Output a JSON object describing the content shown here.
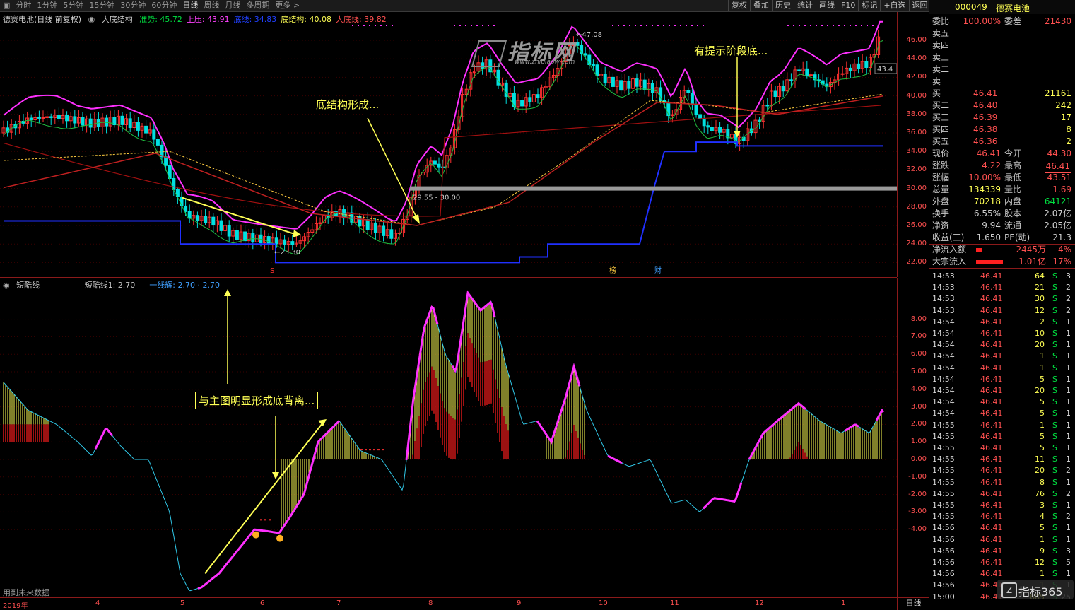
{
  "menu": {
    "tabs": [
      "分时",
      "1分钟",
      "5分钟",
      "15分钟",
      "30分钟",
      "60分钟",
      "日线",
      "周线",
      "月线",
      "多周期",
      "更多 >"
    ],
    "active_tab": "日线",
    "tools": [
      "复权",
      "叠加",
      "历史",
      "统计",
      "画线",
      "F10",
      "标记",
      "+自选",
      "返回"
    ]
  },
  "stock": {
    "code": "000049",
    "name": "德赛电池"
  },
  "main_header": {
    "title": "德赛电池(日线 前复权)",
    "indicator": "大底结构",
    "items": [
      {
        "label": "准势: 45.72",
        "color": "#00e040"
      },
      {
        "label": "上压: 43.91",
        "color": "#ff40ff"
      },
      {
        "label": "底线: 34.83",
        "color": "#2040ff"
      },
      {
        "label": "底结构: 40.08",
        "color": "#ffff55"
      },
      {
        "label": "大底线: 39.82",
        "color": "#ff5050"
      }
    ]
  },
  "indicator_header": {
    "name": "短酷线",
    "items": [
      {
        "label": "短酷线1: 2.70",
        "color": "#c8c8c8"
      },
      {
        "label": "一线辉: 2.70 · 2.70",
        "color": "#40a0ff"
      }
    ]
  },
  "annotations": {
    "bottom_formed": "底结构形成...",
    "stage_bottom": "有提示阶段底...",
    "divergence": "与主图明显形成底背离...",
    "future_data": "用到未来数据"
  },
  "chart_labels": {
    "high": "47.08",
    "low": "23.30",
    "range": "29.55 - 30.00",
    "last": "43.4",
    "marker_bang": "榜",
    "marker_cai": "财",
    "marker_s": "S"
  },
  "watermark": {
    "text": "指标网",
    "url": "www.zhibiaow.com",
    "corner": "指标365"
  },
  "price_axis": [
    "46.00",
    "44.00",
    "42.00",
    "40.00",
    "38.00",
    "36.00",
    "34.00",
    "32.00",
    "30.00",
    "28.00",
    "26.00",
    "24.00",
    "22.00"
  ],
  "indicator_axis": [
    "8.00",
    "7.00",
    "6.00",
    "5.00",
    "4.00",
    "3.00",
    "2.00",
    "1.00",
    "0.00",
    "-1.00",
    "-2.00",
    "-3.00",
    "-4.00"
  ],
  "date_axis": {
    "labels": [
      "2019年",
      "4",
      "5",
      "6",
      "7",
      "8",
      "9",
      "10",
      "11",
      "12",
      "1"
    ],
    "period": "日线"
  },
  "quote": {
    "weibi": {
      "label": "委比",
      "value": "100.00%",
      "label2": "委差",
      "value2": "21430"
    },
    "asks": [
      {
        "label": "卖五",
        "price": "",
        "vol": ""
      },
      {
        "label": "卖四",
        "price": "",
        "vol": ""
      },
      {
        "label": "卖三",
        "price": "",
        "vol": ""
      },
      {
        "label": "卖二",
        "price": "",
        "vol": ""
      },
      {
        "label": "卖一",
        "price": "",
        "vol": ""
      }
    ],
    "bids": [
      {
        "label": "买一",
        "price": "46.41",
        "vol": "21161"
      },
      {
        "label": "买二",
        "price": "46.40",
        "vol": "242"
      },
      {
        "label": "买三",
        "price": "46.39",
        "vol": "17"
      },
      {
        "label": "买四",
        "price": "46.38",
        "vol": "8"
      },
      {
        "label": "买五",
        "price": "46.36",
        "vol": "2"
      }
    ],
    "stats": [
      {
        "l1": "现价",
        "v1": "46.41",
        "l2": "今开",
        "v2": "44.30"
      },
      {
        "l1": "涨跌",
        "v1": "4.22",
        "l2": "最高",
        "v2": "46.41"
      },
      {
        "l1": "涨幅",
        "v1": "10.00%",
        "l2": "最低",
        "v2": "43.51"
      },
      {
        "l1": "总量",
        "v1": "134339",
        "l2": "量比",
        "v2": "1.69"
      },
      {
        "l1": "外盘",
        "v1": "70218",
        "l2": "内盘",
        "v2": "64121"
      },
      {
        "l1": "换手",
        "v1": "6.55%",
        "l2": "股本",
        "v2": "2.07亿"
      },
      {
        "l1": "净资",
        "v1": "9.94",
        "l2": "流通",
        "v2": "2.05亿"
      },
      {
        "l1": "收益(三)",
        "v1": "1.650",
        "l2": "PE(动)",
        "v2": "21.3"
      }
    ],
    "flows": [
      {
        "label": "净流入额",
        "value": "2445万",
        "pct": "4%"
      },
      {
        "label": "大宗流入",
        "value": "1.01亿",
        "pct": "17%"
      }
    ]
  },
  "ticks": [
    [
      "14:53",
      "46.41",
      "64",
      "S",
      "3"
    ],
    [
      "14:53",
      "46.41",
      "21",
      "S",
      "2"
    ],
    [
      "14:53",
      "46.41",
      "30",
      "S",
      "2"
    ],
    [
      "14:53",
      "46.41",
      "12",
      "S",
      "2"
    ],
    [
      "14:54",
      "46.41",
      "2",
      "S",
      "1"
    ],
    [
      "14:54",
      "46.41",
      "10",
      "S",
      "1"
    ],
    [
      "14:54",
      "46.41",
      "20",
      "S",
      "1"
    ],
    [
      "14:54",
      "46.41",
      "1",
      "S",
      "1"
    ],
    [
      "14:54",
      "46.41",
      "1",
      "S",
      "1"
    ],
    [
      "14:54",
      "46.41",
      "5",
      "S",
      "1"
    ],
    [
      "14:54",
      "46.41",
      "20",
      "S",
      "1"
    ],
    [
      "14:54",
      "46.41",
      "5",
      "S",
      "1"
    ],
    [
      "14:54",
      "46.41",
      "5",
      "S",
      "1"
    ],
    [
      "14:55",
      "46.41",
      "1",
      "S",
      "1"
    ],
    [
      "14:55",
      "46.41",
      "5",
      "S",
      "1"
    ],
    [
      "14:55",
      "46.41",
      "5",
      "S",
      "1"
    ],
    [
      "14:55",
      "46.41",
      "11",
      "S",
      "1"
    ],
    [
      "14:55",
      "46.41",
      "20",
      "S",
      "2"
    ],
    [
      "14:55",
      "46.41",
      "8",
      "S",
      "1"
    ],
    [
      "14:55",
      "46.41",
      "76",
      "S",
      "2"
    ],
    [
      "14:55",
      "46.41",
      "3",
      "S",
      "1"
    ],
    [
      "14:55",
      "46.41",
      "4",
      "S",
      "2"
    ],
    [
      "14:56",
      "46.41",
      "5",
      "S",
      "1"
    ],
    [
      "14:56",
      "46.41",
      "1",
      "S",
      "1"
    ],
    [
      "14:56",
      "46.41",
      "9",
      "S",
      "3"
    ],
    [
      "14:56",
      "46.41",
      "12",
      "S",
      "5"
    ],
    [
      "14:56",
      "46.41",
      "1",
      "S",
      "1"
    ],
    [
      "14:56",
      "46.41",
      "1",
      "S",
      "1"
    ],
    [
      "15:00",
      "46.41",
      "685",
      "S",
      "25"
    ]
  ]
}
